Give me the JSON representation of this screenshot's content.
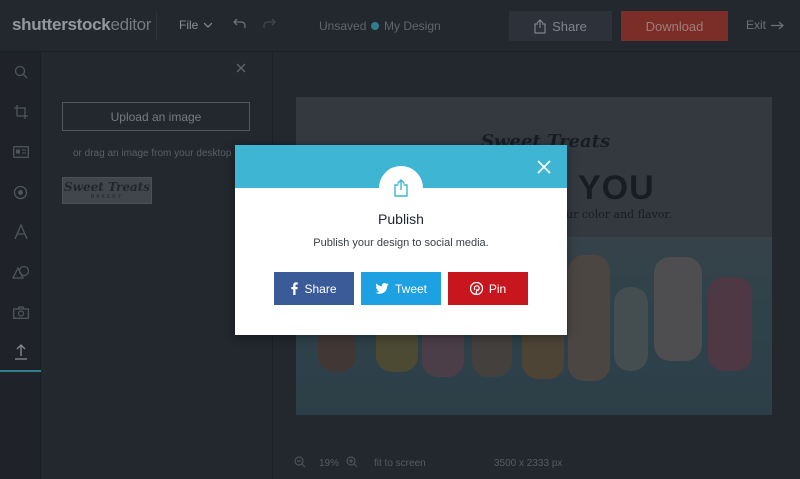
{
  "app": {
    "logo_brand": "shutterstock",
    "logo_suffix": "editor"
  },
  "topbar": {
    "file_label": "File",
    "save_status": "Unsaved",
    "design_name": "My Design",
    "share_label": "Share",
    "download_label": "Download",
    "exit_label": "Exit"
  },
  "sidebar": {
    "tools": [
      "search-icon",
      "crop-icon",
      "layout-icon",
      "filter-icon",
      "text-icon",
      "shapes-icon",
      "camera-icon",
      "upload-icon"
    ],
    "active_tool": "upload-icon"
  },
  "panel": {
    "upload_label": "Upload an image",
    "drag_text": "or drag an image from your desktop",
    "thumb_title": "Sweet Treats",
    "thumb_sub": "BAKERY"
  },
  "canvas": {
    "art_title": "Sweet Treats",
    "art_headline": "YOU",
    "art_subtitle": "ur color and flavor."
  },
  "zoom": {
    "level": "19%",
    "fit_label": "fit to screen",
    "dimensions": "3500 x 2333 px"
  },
  "modal": {
    "title": "Publish",
    "description": "Publish your design to social media.",
    "facebook_label": "Share",
    "twitter_label": "Tweet",
    "pinterest_label": "Pin",
    "header_color": "#3fb5d4",
    "facebook_color": "#3a5a98",
    "twitter_color": "#1da1e2",
    "pinterest_color": "#c8161e"
  }
}
